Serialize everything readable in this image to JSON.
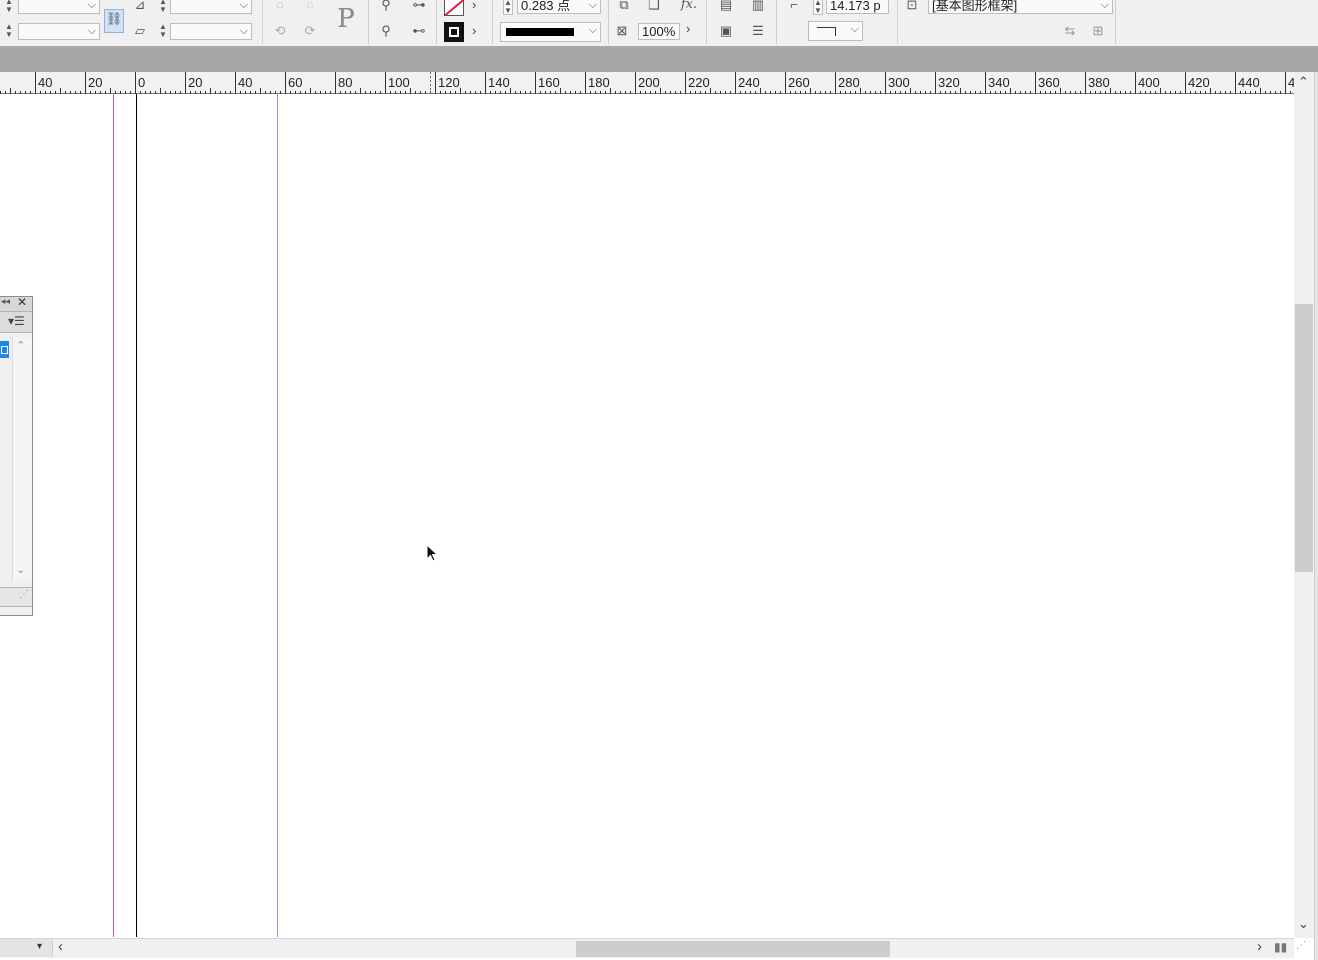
{
  "control_bar": {
    "stroke_weight": "0.283 点",
    "reference_point_value": "14.173 p",
    "scale_percent": "100%",
    "object_style": "[基本图形框架]",
    "icons": [
      "constrain-proportions-icon",
      "shear-icon",
      "rotate-icon",
      "select-container-icon",
      "select-content-icon",
      "fill-icon",
      "stroke-icon",
      "text-frame-options-icon",
      "drop-shadow-icon",
      "effects-icon",
      "text-wrap-icon",
      "auto-fit-icon",
      "corner-shape-icon"
    ]
  },
  "ruler": {
    "labels": [
      "40",
      "20",
      "0",
      "20",
      "40",
      "60",
      "80",
      "100",
      "120",
      "140",
      "160",
      "180",
      "200",
      "220",
      "240",
      "260",
      "280",
      "300",
      "320",
      "340",
      "360",
      "380",
      "400",
      "420",
      "440",
      "4"
    ]
  },
  "colors": {
    "bleed_guide": "#e05a7a",
    "page_edge": "#000000",
    "margin_guide": "#9a8ff0",
    "ui_background": "#f0f0f0",
    "pasteboard_strip": "#a7a7a7",
    "selection_blue": "#1e88e5"
  }
}
